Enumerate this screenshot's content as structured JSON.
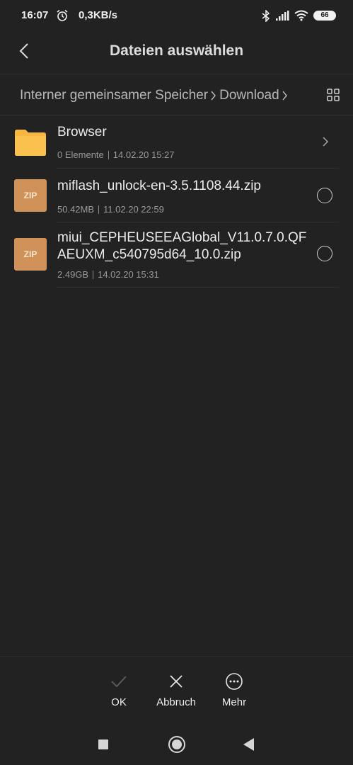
{
  "status_bar": {
    "time": "16:07",
    "net_speed": "0,3KB/s",
    "battery": "66"
  },
  "header": {
    "title": "Dateien auswählen"
  },
  "breadcrumb": {
    "items": [
      "Interner gemeinsamer Speicher",
      "Download"
    ]
  },
  "files": [
    {
      "type": "folder",
      "name": "Browser",
      "size": "0 Elemente",
      "date": "14.02.20 15:27"
    },
    {
      "type": "zip",
      "icon_label": "ZIP",
      "name": "miflash_unlock-en-3.5.1108.44.zip",
      "size": "50.42MB",
      "date": "11.02.20 22:59"
    },
    {
      "type": "zip",
      "icon_label": "ZIP",
      "name": "miui_CEPHEUSEEAGlobal_V11.0.7.0.QFAEUXM_c540795d64_10.0.zip",
      "size": "2.49GB",
      "date": "14.02.20 15:31"
    }
  ],
  "actions": {
    "ok": "OK",
    "cancel": "Abbruch",
    "more": "Mehr"
  },
  "colors": {
    "background": "#222222",
    "folder": "#f6b63f",
    "zip": "#d1925a"
  }
}
